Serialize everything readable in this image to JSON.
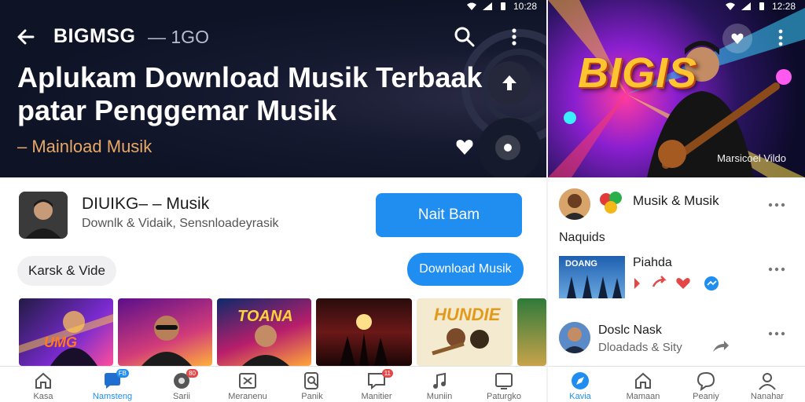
{
  "left_panel": {
    "status_time": "10:28",
    "app_bar": {
      "title": "BIGMSG",
      "subtitle": "— 1GO"
    },
    "headline": {
      "line1": "Aplukam Download Musik Terbaak",
      "line2": "patar Penggemar Musik",
      "sub": "– Mainload Musik"
    },
    "app": {
      "title": "DIUIKG– – Musik",
      "description": "Downlk & Vidaik, Sensnloadeyrasik",
      "primary_button": "Nait Bam"
    },
    "chip_label": "Karsk & Vide",
    "download_button": "Download Musik",
    "thumbnails": [
      {
        "caption": "UMG"
      },
      {
        "caption": ""
      },
      {
        "caption": "TOANA"
      },
      {
        "caption": ""
      },
      {
        "caption": "HUNDIE"
      },
      {
        "caption": ""
      }
    ],
    "bottom_nav": [
      {
        "label": "Kasa",
        "icon": "home-icon",
        "badge": ""
      },
      {
        "label": "Namsteng",
        "icon": "chat-icon",
        "badge": "FB"
      },
      {
        "label": "Sarii",
        "icon": "record-icon",
        "badge": "80"
      },
      {
        "label": "Meranenu",
        "icon": "film-icon",
        "badge": ""
      },
      {
        "label": "Panik",
        "icon": "search-doc-icon",
        "badge": ""
      },
      {
        "label": "Manitier",
        "icon": "message-icon",
        "badge": "11"
      },
      {
        "label": "Muniin",
        "icon": "music-note-icon",
        "badge": ""
      },
      {
        "label": "Paturgko",
        "icon": "tablet-icon",
        "badge": ""
      }
    ]
  },
  "right_panel": {
    "status_time": "12:28",
    "hero": {
      "title": "BIGIS",
      "caption": "Marsicoel Vildo"
    },
    "post1": {
      "title": "Musik & Musik"
    },
    "section_label": "Naquids",
    "post2": {
      "title": "Piahda",
      "thumb_caption": "DOANG"
    },
    "post3": {
      "title": "Doslc Nask",
      "subtitle": "Dloadads & Sity"
    },
    "bottom_nav": [
      {
        "label": "Kavia",
        "icon": "compass-icon"
      },
      {
        "label": "Mamaan",
        "icon": "home-icon"
      },
      {
        "label": "Peaniy",
        "icon": "chat-bubble-icon"
      },
      {
        "label": "Nanahar",
        "icon": "profile-icon"
      }
    ]
  },
  "colors": {
    "accent_blue": "#1f8ef0",
    "header_dark": "#0e1326",
    "headline_orange": "#e8a867",
    "hero_gold": "#ffc531",
    "action_red": "#e24848"
  }
}
